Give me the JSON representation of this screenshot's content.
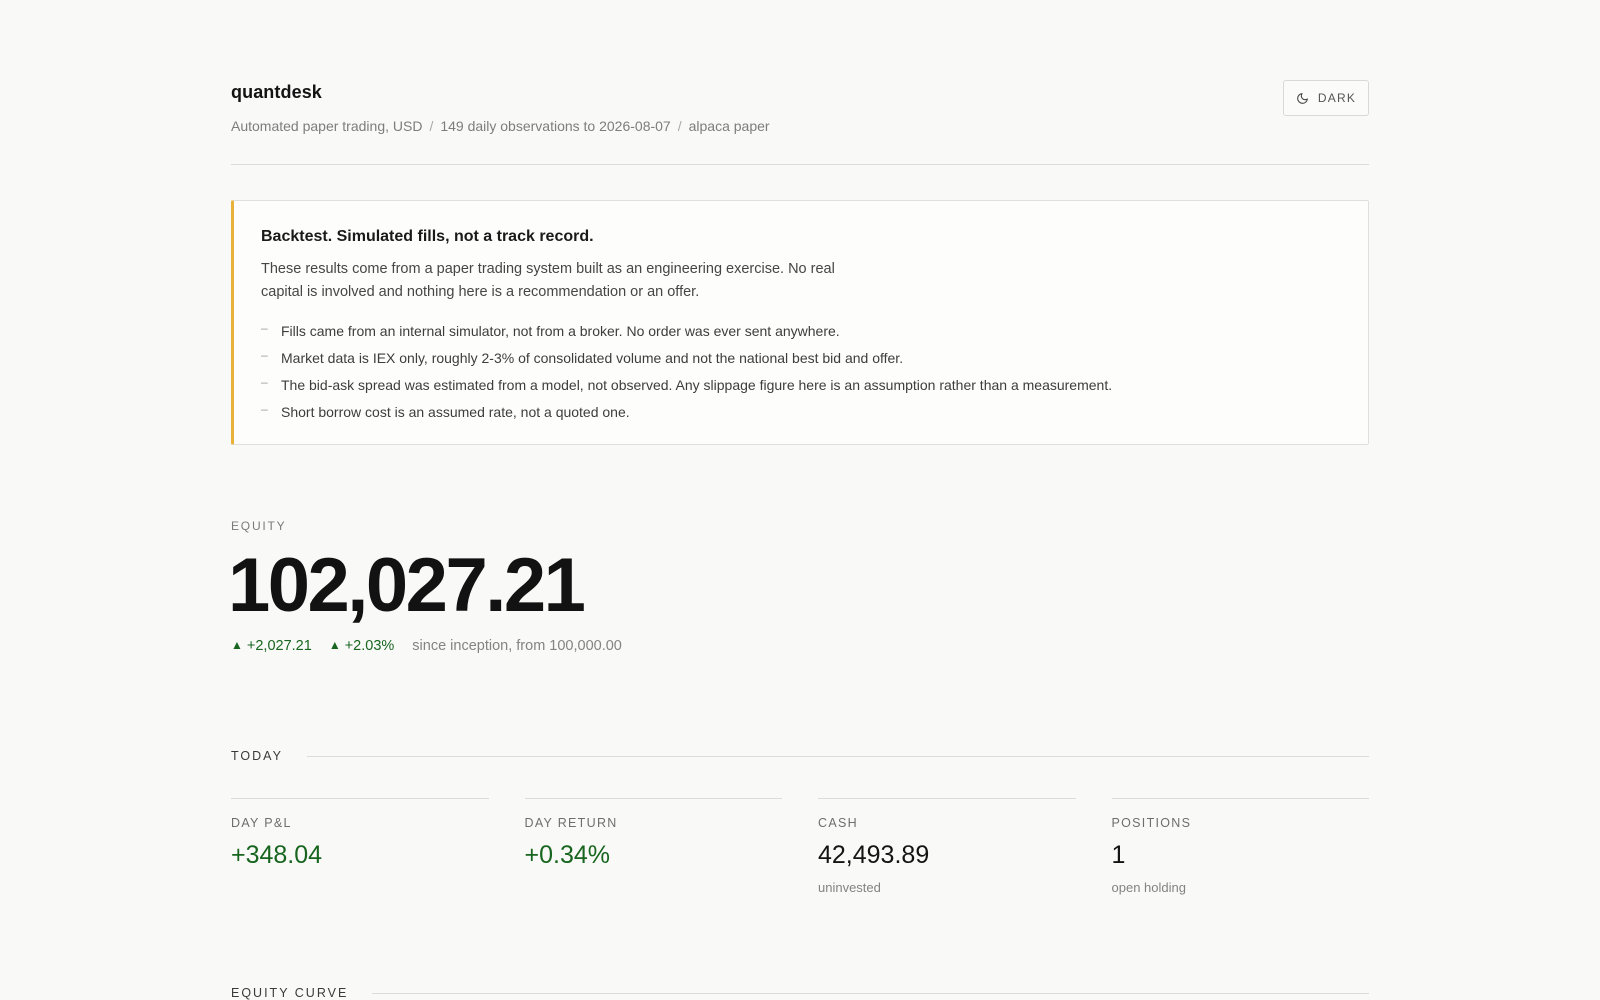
{
  "header": {
    "app_name": "quantdesk",
    "meta": [
      "Automated paper trading, USD",
      "149 daily observations to 2026-08-07",
      "alpaca paper"
    ],
    "theme_button": {
      "label": "DARK",
      "icon": "moon-icon"
    }
  },
  "disclaimer": {
    "title": "Backtest. Simulated fills, not a track record.",
    "body": "These results come from a paper trading system built as an engineering exercise. No real capital is involved and nothing here is a recommendation or an offer.",
    "items": [
      "Fills came from an internal simulator, not from a broker. No order was ever sent anywhere.",
      "Market data is IEX only, roughly 2-3% of consolidated volume and not the national best bid and offer.",
      "The bid-ask spread was estimated from a model, not observed. Any slippage figure here is an assumption rather than a measurement.",
      "Short borrow cost is an assumed rate, not a quoted one."
    ],
    "accent_color": "#e8b23a"
  },
  "equity": {
    "label": "EQUITY",
    "value": "102,027.21",
    "change_abs": "+2,027.21",
    "change_pct": "+2.03%",
    "up_glyph": "▲",
    "since": "since inception, from 100,000.00",
    "positive_color": "#17651f"
  },
  "today": {
    "label": "TODAY",
    "stats": [
      {
        "label": "DAY P&L",
        "value": "+348.04",
        "sub": "",
        "positive": true
      },
      {
        "label": "DAY RETURN",
        "value": "+0.34%",
        "sub": "",
        "positive": true
      },
      {
        "label": "CASH",
        "value": "42,493.89",
        "sub": "uninvested",
        "positive": false
      },
      {
        "label": "POSITIONS",
        "value": "1",
        "sub": "open holding",
        "positive": false
      }
    ]
  },
  "equity_curve": {
    "label": "EQUITY CURVE"
  }
}
